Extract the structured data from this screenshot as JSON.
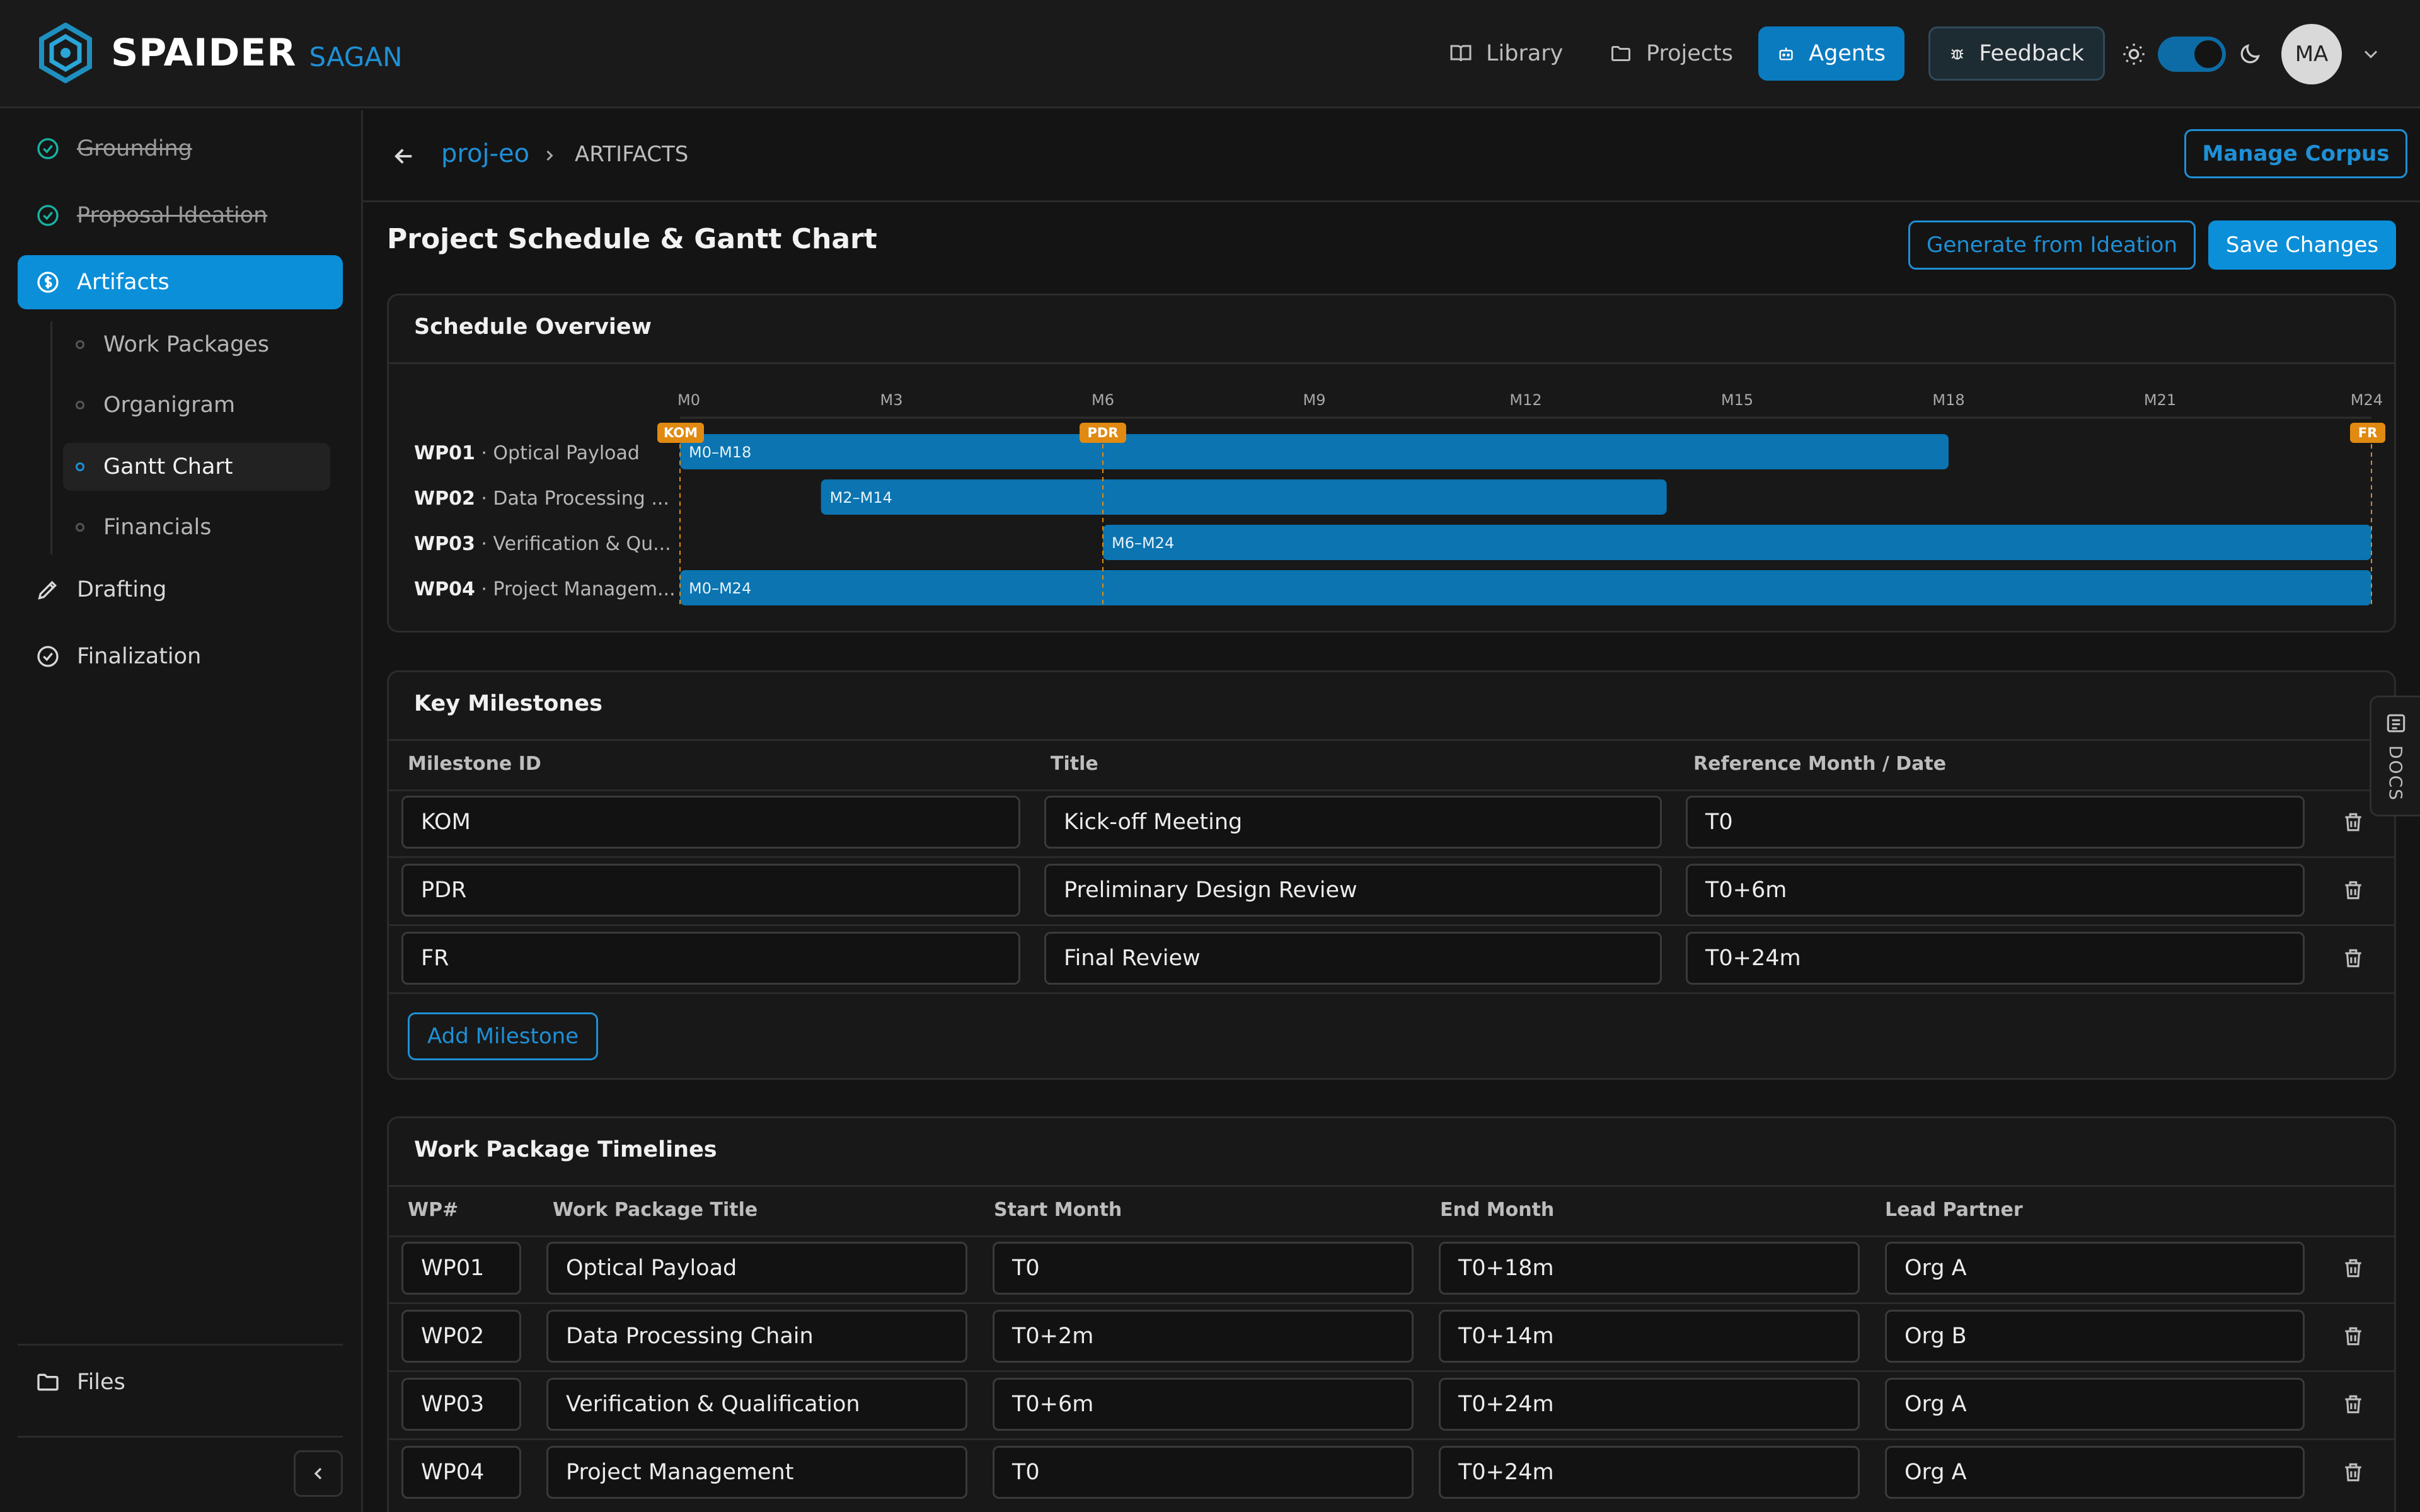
{
  "app": {
    "brand": "SPAIDER",
    "brand_sub": "SAGAN",
    "accent": "#0b8fd9"
  },
  "topnav": {
    "library": "Library",
    "projects": "Projects",
    "agents": "Agents",
    "feedback": "Feedback",
    "avatar": "MA"
  },
  "sidebar": {
    "items": [
      {
        "label": "Grounding",
        "state": "done"
      },
      {
        "label": "Proposal Ideation",
        "state": "done"
      },
      {
        "label": "Artifacts",
        "state": "active"
      },
      {
        "label": "Drafting",
        "state": "todo"
      },
      {
        "label": "Finalization",
        "state": "todo"
      }
    ],
    "sub_items": [
      "Work Packages",
      "Organigram",
      "Gantt Chart",
      "Financials"
    ],
    "files": "Files"
  },
  "breadcrumb": {
    "project": "proj-eo",
    "current": "ARTIFACTS",
    "manage": "Manage Corpus"
  },
  "page": {
    "title": "Project Schedule & Gantt Chart",
    "generate": "Generate from Ideation",
    "save": "Save Changes"
  },
  "overview": {
    "title": "Schedule Overview",
    "month_ticks": [
      "M0",
      "M3",
      "M6",
      "M9",
      "M12",
      "M15",
      "M18",
      "M21",
      "M24"
    ],
    "max_month": 24,
    "bar_color": "#0b74b1",
    "milestone_color": "#e08a12"
  },
  "chart_data": {
    "type": "gantt",
    "x_unit": "month",
    "xlim": [
      0,
      24
    ],
    "tasks": [
      {
        "id": "WP01",
        "name": "Optical Payload",
        "short": "Optical Payload",
        "start": 0,
        "end": 18,
        "label": "M0–M18"
      },
      {
        "id": "WP02",
        "name": "Data Processing Chain",
        "short": "Data Processing ...",
        "start": 2,
        "end": 14,
        "label": "M2–M14"
      },
      {
        "id": "WP03",
        "name": "Verification & Qualification",
        "short": "Verification & Qu...",
        "start": 6,
        "end": 24,
        "label": "M6–M24"
      },
      {
        "id": "WP04",
        "name": "Project Management",
        "short": "Project Managem...",
        "start": 0,
        "end": 24,
        "label": "M0–M24"
      }
    ],
    "milestones": [
      {
        "id": "KOM",
        "month": 0
      },
      {
        "id": "PDR",
        "month": 6
      },
      {
        "id": "FR",
        "month": 24
      }
    ]
  },
  "milestones": {
    "title": "Key Milestones",
    "columns": [
      "Milestone ID",
      "Title",
      "Reference Month / Date"
    ],
    "rows": [
      {
        "id": "KOM",
        "title": "Kick-off Meeting",
        "ref": "T0"
      },
      {
        "id": "PDR",
        "title": "Preliminary Design Review",
        "ref": "T0+6m"
      },
      {
        "id": "FR",
        "title": "Final Review",
        "ref": "T0+24m"
      }
    ],
    "add": "Add Milestone"
  },
  "timelines": {
    "title": "Work Package Timelines",
    "columns": [
      "WP#",
      "Work Package Title",
      "Start Month",
      "End Month",
      "Lead Partner"
    ],
    "rows": [
      {
        "wp": "WP01",
        "title": "Optical Payload",
        "start": "T0",
        "end": "T0+18m",
        "lead": "Org A"
      },
      {
        "wp": "WP02",
        "title": "Data Processing Chain",
        "start": "T0+2m",
        "end": "T0+14m",
        "lead": "Org B"
      },
      {
        "wp": "WP03",
        "title": "Verification & Qualification",
        "start": "T0+6m",
        "end": "T0+24m",
        "lead": "Org A"
      },
      {
        "wp": "WP04",
        "title": "Project Management",
        "start": "T0",
        "end": "T0+24m",
        "lead": "Org A"
      }
    ]
  },
  "docs_tab": "DOCS",
  "icons": {
    "logo": "hexagon-logo-icon",
    "library": "book-icon",
    "projects": "folder-icon",
    "agents": "robot-icon",
    "feedback": "bug-icon",
    "theme_light": "sun-icon",
    "theme_dark": "moon-icon",
    "delete": "trash-icon"
  }
}
